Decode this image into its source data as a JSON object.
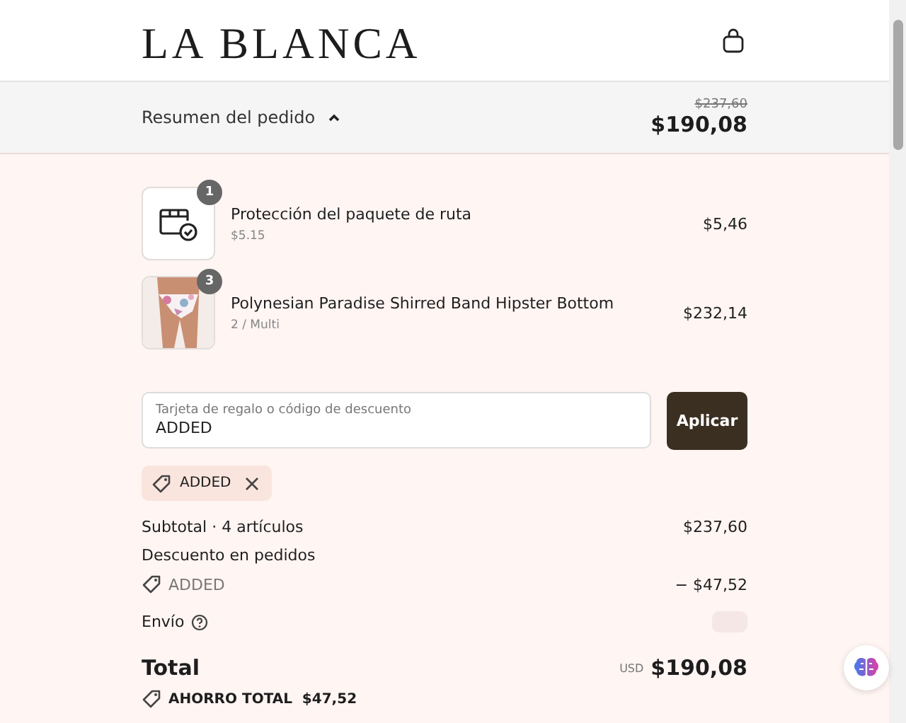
{
  "header": {
    "logo": "LA BLANCA"
  },
  "summary_bar": {
    "label": "Resumen del pedido",
    "expanded": true,
    "original_total": "$237,60",
    "total": "$190,08"
  },
  "items": [
    {
      "kind": "icon",
      "quantity": "1",
      "name": "Protección del paquete de ruta",
      "detail": "$5.15",
      "price": "$5,46"
    },
    {
      "kind": "picture",
      "quantity": "3",
      "name": "Polynesian Paradise Shirred Band Hipster Bottom",
      "detail": "2 / Multi",
      "price": "$232,14"
    }
  ],
  "discount": {
    "label": "Tarjeta de regalo o código de descuento",
    "value": "ADDED",
    "button": "Aplicar",
    "applied_code": "ADDED"
  },
  "totals": {
    "subtotal_label": "Subtotal · 4 artículos",
    "subtotal": "$237,60",
    "discount_label": "Descuento en pedidos",
    "discount_code": "ADDED",
    "discount_amount": "− $47,52",
    "shipping_label": "Envío",
    "total_label": "Total",
    "currency": "USD",
    "total": "$190,08",
    "savings": "AHORRO TOTAL  $47,52"
  }
}
